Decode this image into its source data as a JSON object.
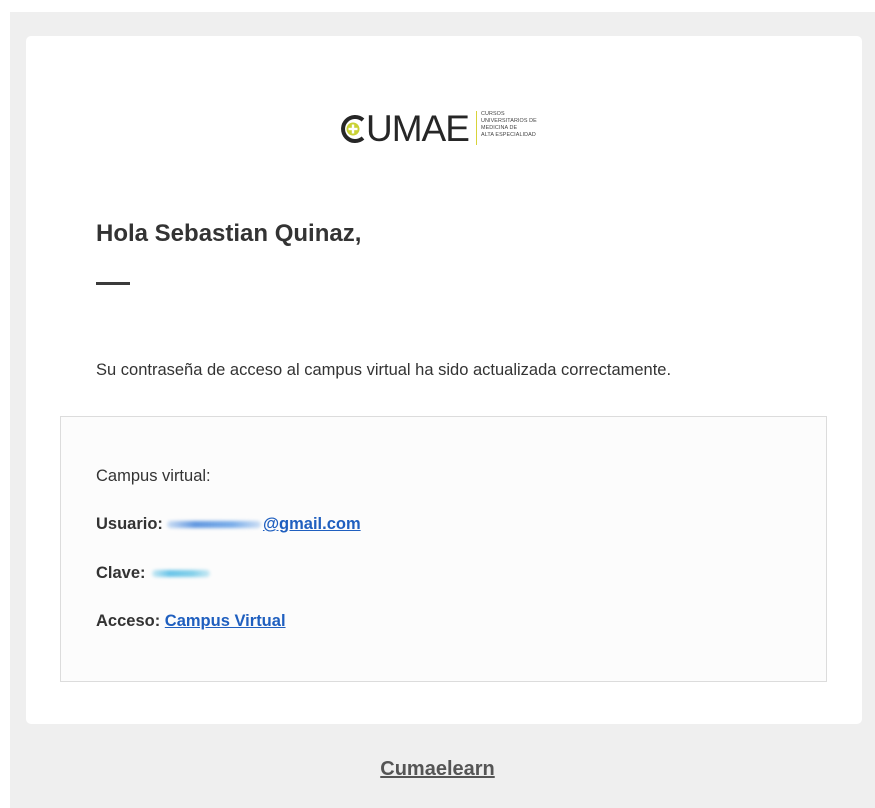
{
  "logo": {
    "wordmark": "UMAE",
    "subtitle_lines": [
      "CURSOS",
      "UNIVERSITARIOS DE",
      "MEDICINA DE",
      "ALTA ESPECIALIDAD"
    ],
    "accent_color": "#c9d134",
    "icon": "plus-circle-icon"
  },
  "greeting": "Hola Sebastian Quinaz,",
  "message": "Su contraseña de acceso al campus virtual ha sido actualizada correctamente.",
  "details": {
    "heading": "Campus virtual:",
    "user_label": "Usuario:",
    "user_email_suffix": "@gmail.com",
    "password_label": "Clave:",
    "access_label": "Acceso:",
    "access_link": "Campus Virtual"
  },
  "footer": {
    "link": "Cumaelearn"
  },
  "colors": {
    "background": "#efefef",
    "card": "#ffffff",
    "link": "#1f5fbf",
    "text": "#333333"
  }
}
